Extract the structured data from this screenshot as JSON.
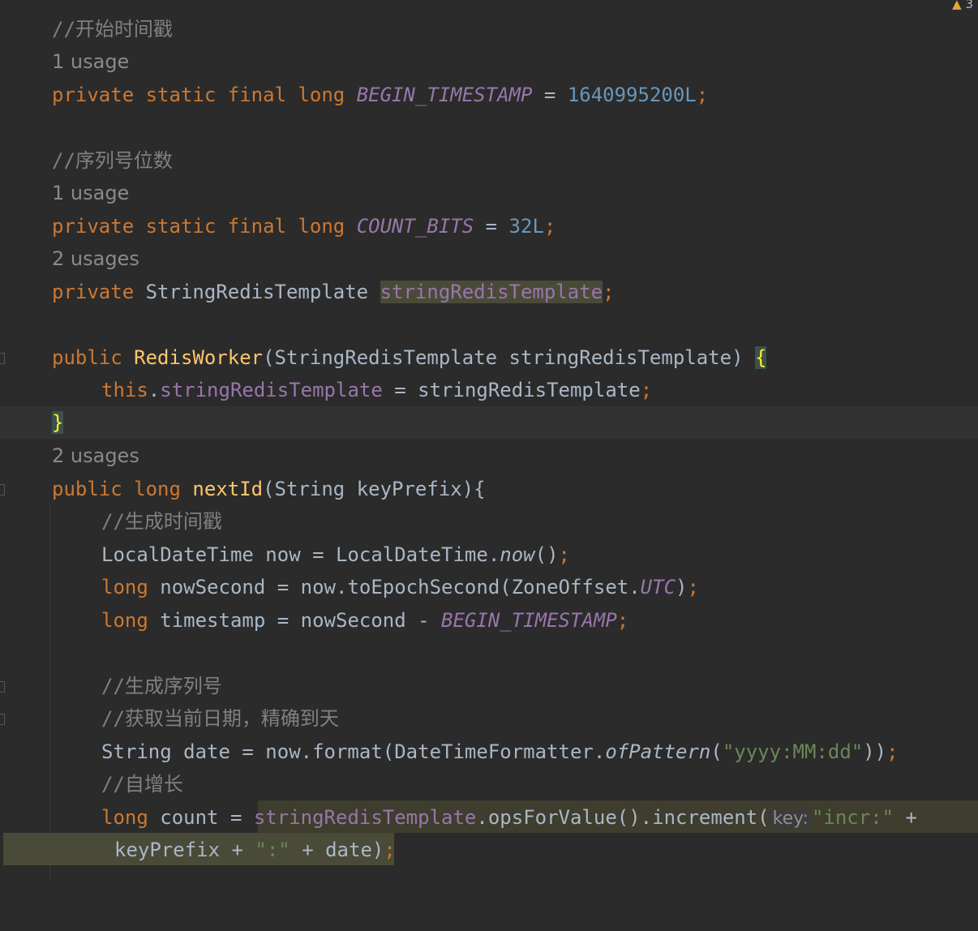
{
  "editor": {
    "warning_count": "3",
    "lines": {
      "c1": "//开始时间戳",
      "u1": "1 usage",
      "l1_kw": "private static final long ",
      "l1_name": "BEGIN_TIMESTAMP",
      "l1_eq": " = ",
      "l1_num": "1640995200L",
      "l1_semi": ";",
      "c2": "//序列号位数",
      "u2": "1 usage",
      "l2_kw": "private static final long ",
      "l2_name": "COUNT_BITS",
      "l2_eq": " = ",
      "l2_num": "32L",
      "l2_semi": ";",
      "u3": "2 usages",
      "l3_kw": "private ",
      "l3_type": "StringRedisTemplate ",
      "l3_name": "stringRedisTemplate",
      "l3_semi": ";",
      "l4_kw": "public ",
      "l4_fn": "RedisWorker",
      "l4_rest": "(StringRedisTemplate stringRedisTemplate) ",
      "l4_brace": "{",
      "l5_kw": "this",
      "l5_dot": ".",
      "l5_fld": "stringRedisTemplate",
      "l5_rest": " = stringRedisTemplate",
      "l5_semi": ";",
      "l6_brace": "}",
      "u4": "2 usages",
      "l7_kw": "public long ",
      "l7_fn": "nextId",
      "l7_rest": "(String keyPrefix){",
      "c3": "//生成时间戳",
      "l8_a": "LocalDateTime now = LocalDateTime.",
      "l8_it": "now",
      "l8_b": "()",
      "l8_semi": ";",
      "l9_kw": "long ",
      "l9_a": "nowSecond = now.toEpochSecond(ZoneOffset.",
      "l9_it": "UTC",
      "l9_b": ")",
      "l9_semi": ";",
      "l10_kw": "long ",
      "l10_a": "timestamp = nowSecond - ",
      "l10_it": "BEGIN_TIMESTAMP",
      "l10_semi": ";",
      "c4": "//生成序列号",
      "c5": "//获取当前日期，精确到天",
      "l11_a": "String date = now.format(DateTimeFormatter.",
      "l11_it": "ofPattern",
      "l11_b": "(",
      "l11_str": "\"yyyy:MM:dd\"",
      "l11_c": "))",
      "l11_semi": ";",
      "c6": "//自增长",
      "l12_kw": "long ",
      "l12_a": "count = ",
      "l12_fld": "stringRedisTemplate",
      "l12_b": ".opsForValue().increment(",
      "l12_hint": "key:",
      "l12_str": "\"incr:\"",
      "l12_c": " +",
      "l13_a": "keyPrefix + ",
      "l13_str": "\":\"",
      "l13_b": " + date)",
      "l13_semi": ";"
    }
  }
}
